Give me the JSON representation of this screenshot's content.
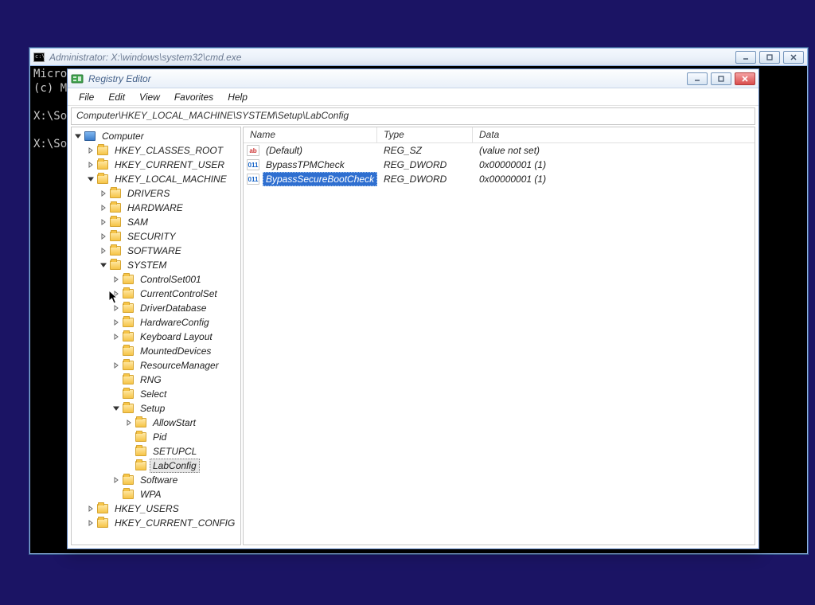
{
  "cmd": {
    "title": "Administrator: X:\\windows\\system32\\cmd.exe",
    "lines": [
      "Micro",
      "(c) M",
      "",
      "X:\\So",
      "",
      "X:\\So"
    ]
  },
  "regedit": {
    "title": "Registry Editor",
    "menu": {
      "file": "File",
      "edit": "Edit",
      "view": "View",
      "favorites": "Favorites",
      "help": "Help"
    },
    "address": "Computer\\HKEY_LOCAL_MACHINE\\SYSTEM\\Setup\\LabConfig",
    "columns": {
      "name": "Name",
      "type": "Type",
      "data": "Data"
    },
    "values": [
      {
        "icon": "ab",
        "iconKind": "str",
        "name": "(Default)",
        "type": "REG_SZ",
        "data": "(value not set)",
        "selected": false
      },
      {
        "icon": "011",
        "iconKind": "num",
        "name": "BypassTPMCheck",
        "type": "REG_DWORD",
        "data": "0x00000001 (1)",
        "selected": false
      },
      {
        "icon": "011",
        "iconKind": "num",
        "name": "BypassSecureBootCheck",
        "type": "REG_DWORD",
        "data": "0x00000001 (1)",
        "selected": true
      }
    ],
    "tree": [
      {
        "depth": 0,
        "label": "Computer",
        "expander": "down",
        "iconKind": "computer",
        "selected": false
      },
      {
        "depth": 1,
        "label": "HKEY_CLASSES_ROOT",
        "expander": "right",
        "iconKind": "folder"
      },
      {
        "depth": 1,
        "label": "HKEY_CURRENT_USER",
        "expander": "right",
        "iconKind": "folder"
      },
      {
        "depth": 1,
        "label": "HKEY_LOCAL_MACHINE",
        "expander": "down",
        "iconKind": "folder"
      },
      {
        "depth": 2,
        "label": "DRIVERS",
        "expander": "right",
        "iconKind": "folder"
      },
      {
        "depth": 2,
        "label": "HARDWARE",
        "expander": "right",
        "iconKind": "folder"
      },
      {
        "depth": 2,
        "label": "SAM",
        "expander": "right",
        "iconKind": "folder"
      },
      {
        "depth": 2,
        "label": "SECURITY",
        "expander": "right",
        "iconKind": "folder"
      },
      {
        "depth": 2,
        "label": "SOFTWARE",
        "expander": "right",
        "iconKind": "folder"
      },
      {
        "depth": 2,
        "label": "SYSTEM",
        "expander": "down",
        "iconKind": "folder"
      },
      {
        "depth": 3,
        "label": "ControlSet001",
        "expander": "right",
        "iconKind": "folder"
      },
      {
        "depth": 3,
        "label": "CurrentControlSet",
        "expander": "right",
        "iconKind": "folder"
      },
      {
        "depth": 3,
        "label": "DriverDatabase",
        "expander": "right",
        "iconKind": "folder"
      },
      {
        "depth": 3,
        "label": "HardwareConfig",
        "expander": "right",
        "iconKind": "folder"
      },
      {
        "depth": 3,
        "label": "Keyboard Layout",
        "expander": "right",
        "iconKind": "folder"
      },
      {
        "depth": 3,
        "label": "MountedDevices",
        "expander": "none",
        "iconKind": "folder"
      },
      {
        "depth": 3,
        "label": "ResourceManager",
        "expander": "right",
        "iconKind": "folder"
      },
      {
        "depth": 3,
        "label": "RNG",
        "expander": "none",
        "iconKind": "folder"
      },
      {
        "depth": 3,
        "label": "Select",
        "expander": "none",
        "iconKind": "folder"
      },
      {
        "depth": 3,
        "label": "Setup",
        "expander": "down",
        "iconKind": "folder"
      },
      {
        "depth": 4,
        "label": "AllowStart",
        "expander": "right",
        "iconKind": "folder"
      },
      {
        "depth": 4,
        "label": "Pid",
        "expander": "none",
        "iconKind": "folder"
      },
      {
        "depth": 4,
        "label": "SETUPCL",
        "expander": "none",
        "iconKind": "folder"
      },
      {
        "depth": 4,
        "label": "LabConfig",
        "expander": "none",
        "iconKind": "folder",
        "selected": true
      },
      {
        "depth": 3,
        "label": "Software",
        "expander": "right",
        "iconKind": "folder"
      },
      {
        "depth": 3,
        "label": "WPA",
        "expander": "none",
        "iconKind": "folder"
      },
      {
        "depth": 1,
        "label": "HKEY_USERS",
        "expander": "right",
        "iconKind": "folder"
      },
      {
        "depth": 1,
        "label": "HKEY_CURRENT_CONFIG",
        "expander": "right",
        "iconKind": "folder"
      }
    ]
  }
}
